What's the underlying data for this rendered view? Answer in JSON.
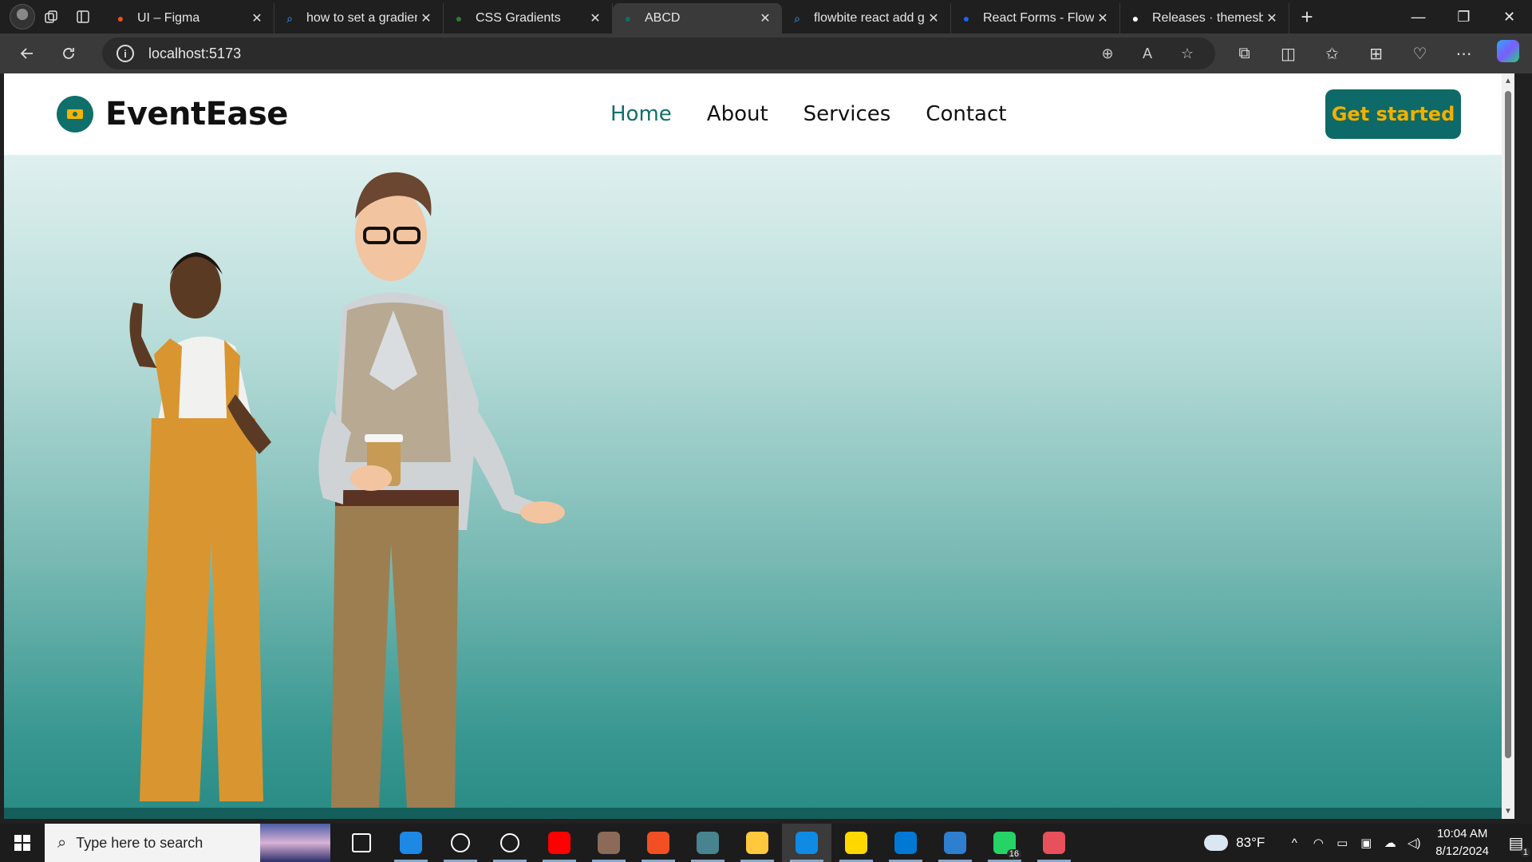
{
  "browser": {
    "tabs": [
      {
        "title": "UI – Figma",
        "favicon": "figma-icon",
        "color": "#f24e1e"
      },
      {
        "title": "how to set a gradient",
        "favicon": "search-icon",
        "color": "#4aa3ff"
      },
      {
        "title": "CSS Gradients",
        "favicon": "w3-icon",
        "color": "#2e7d32"
      },
      {
        "title": "ABCD",
        "favicon": "site-icon",
        "color": "#0f6f6a",
        "active": true
      },
      {
        "title": "flowbite react add g",
        "favicon": "search-icon",
        "color": "#4aa3ff"
      },
      {
        "title": "React Forms - Flowb",
        "favicon": "flowbite-icon",
        "color": "#1c64f2"
      },
      {
        "title": "Releases · themesb",
        "favicon": "github-icon",
        "color": "#ffffff"
      }
    ],
    "new_tab": "+",
    "url": "localhost:5173",
    "window_controls": {
      "minimize": "—",
      "restore": "❐",
      "close": "✕"
    }
  },
  "site": {
    "brand": "EventEase",
    "nav": [
      {
        "label": "Home",
        "active": true
      },
      {
        "label": "About"
      },
      {
        "label": "Services"
      },
      {
        "label": "Contact"
      }
    ],
    "cta": "Get started",
    "colors": {
      "primary": "#0e6a68",
      "accent": "#f2b000",
      "nav_active": "#126e6a"
    }
  },
  "taskbar": {
    "search_placeholder": "Type here to search",
    "apps": [
      {
        "name": "task-view-icon",
        "color": "#ffffff"
      },
      {
        "name": "mail-icon",
        "color": "#1e88e5"
      },
      {
        "name": "github-desktop-icon",
        "color": "#ffffff"
      },
      {
        "name": "app-store-icon",
        "color": "#ffffff"
      },
      {
        "name": "youtube-icon",
        "color": "#ff0000"
      },
      {
        "name": "photo-app-icon",
        "color": "#8b6a5a"
      },
      {
        "name": "microsoft-store-icon",
        "color": "#f25022"
      },
      {
        "name": "electron-app-icon",
        "color": "#47848f"
      },
      {
        "name": "file-explorer-icon",
        "color": "#ffc83d"
      },
      {
        "name": "edge-icon",
        "color": "#0f8be6"
      },
      {
        "name": "sticky-notes-icon",
        "color": "#ffd800"
      },
      {
        "name": "vscode-icon",
        "color": "#0078d4"
      },
      {
        "name": "paint-icon",
        "color": "#2f7fd0"
      },
      {
        "name": "whatsapp-icon",
        "color": "#25d366",
        "badge": "16"
      },
      {
        "name": "snipping-tool-icon",
        "color": "#e8505b"
      }
    ],
    "weather": "83°F",
    "time": "10:04 AM",
    "date": "8/12/2024",
    "notification_count": "1"
  }
}
